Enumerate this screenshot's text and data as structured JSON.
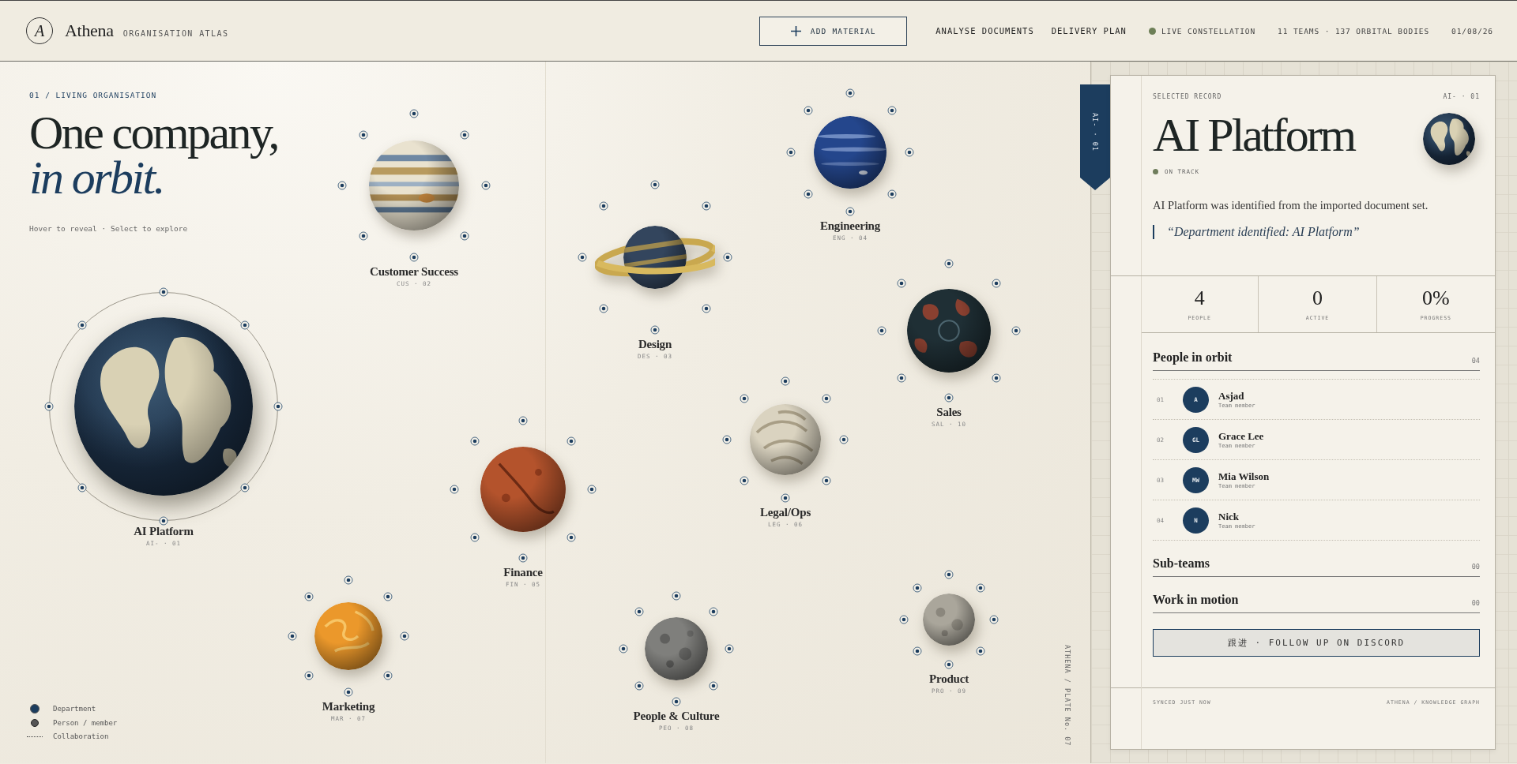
{
  "header": {
    "monogram": "A",
    "brand": "Athena",
    "subtitle": "ORGANISATION ATLAS",
    "actions": [
      {
        "label": "ADD MATERIAL",
        "kind": "primary"
      },
      {
        "label": "ANALYSE DOCUMENTS",
        "kind": "link"
      },
      {
        "label": "DELIVERY PLAN",
        "kind": "link"
      }
    ],
    "live": {
      "label": "LIVE CONSTELLATION",
      "on": true
    },
    "summary": "11 TEAMS · 137 ORBITAL BODIES",
    "date": "01/08/26"
  },
  "intro": {
    "eyebrow": "01 / LIVING ORGANISATION",
    "title": "One company,",
    "title_accent": "in orbit.",
    "hint": "Hover to reveal · Select to explore"
  },
  "planets": [
    {
      "name": "AI Platform",
      "code": "AI- · 01",
      "kind": "earth",
      "selected": true
    },
    {
      "name": "Customer Success",
      "code": "CUS · 02",
      "kind": "banded",
      "selected": false
    },
    {
      "name": "Design",
      "code": "DES · 03",
      "kind": "ringed",
      "selected": false
    },
    {
      "name": "Engineering",
      "code": "ENG · 04",
      "kind": "storm",
      "selected": false
    },
    {
      "name": "Sales",
      "code": "SAL · 10",
      "kind": "lava",
      "selected": false
    },
    {
      "name": "Legal/Ops",
      "code": "LEG · 06",
      "kind": "cloudy",
      "selected": false
    },
    {
      "name": "Finance",
      "code": "FIN · 05",
      "kind": "rusty",
      "selected": false
    },
    {
      "name": "Marketing",
      "code": "MAR · 07",
      "kind": "fiery",
      "selected": false
    },
    {
      "name": "People & Culture",
      "code": "PEO · 08",
      "kind": "cratered",
      "selected": false
    },
    {
      "name": "Product",
      "code": "PRO · 09",
      "kind": "moon",
      "selected": false
    }
  ],
  "legend": [
    {
      "label": "Department",
      "kind": "department"
    },
    {
      "label": "Person / member",
      "kind": "person"
    },
    {
      "label": "Collaboration",
      "kind": "collaboration"
    }
  ],
  "plate": "ATHENA / PLATE No. 07",
  "record": {
    "tab": "AI- · 01",
    "label": "SELECTED RECORD",
    "code": "AI- · 01",
    "title": "AI Platform",
    "kind": "earth",
    "status": "ON TRACK",
    "description": "AI Platform was identified from the imported document set.",
    "quote": "“Department identified: AI Platform”",
    "stats": [
      {
        "value": "4",
        "label": "PEOPLE"
      },
      {
        "value": "0",
        "label": "ACTIVE"
      },
      {
        "value": "0%",
        "label": "PROGRESS"
      }
    ],
    "sections": [
      {
        "title": "People in orbit",
        "count": "04",
        "people": [
          {
            "index": "01",
            "initials": "A",
            "name": "Asjad",
            "role": "Team member"
          },
          {
            "index": "02",
            "initials": "GL",
            "name": "Grace Lee",
            "role": "Team member"
          },
          {
            "index": "03",
            "initials": "MW",
            "name": "Mia Wilson",
            "role": "Team member"
          },
          {
            "index": "04",
            "initials": "N",
            "name": "Nick",
            "role": "Team member"
          }
        ]
      },
      {
        "title": "Sub-teams",
        "count": "00"
      },
      {
        "title": "Work in motion",
        "count": "00"
      }
    ],
    "action": "跟进 · FOLLOW UP ON DISCORD",
    "footer_left": "SYNCED JUST NOW",
    "footer_right": "ATHENA / KNOWLEDGE GRAPH"
  }
}
